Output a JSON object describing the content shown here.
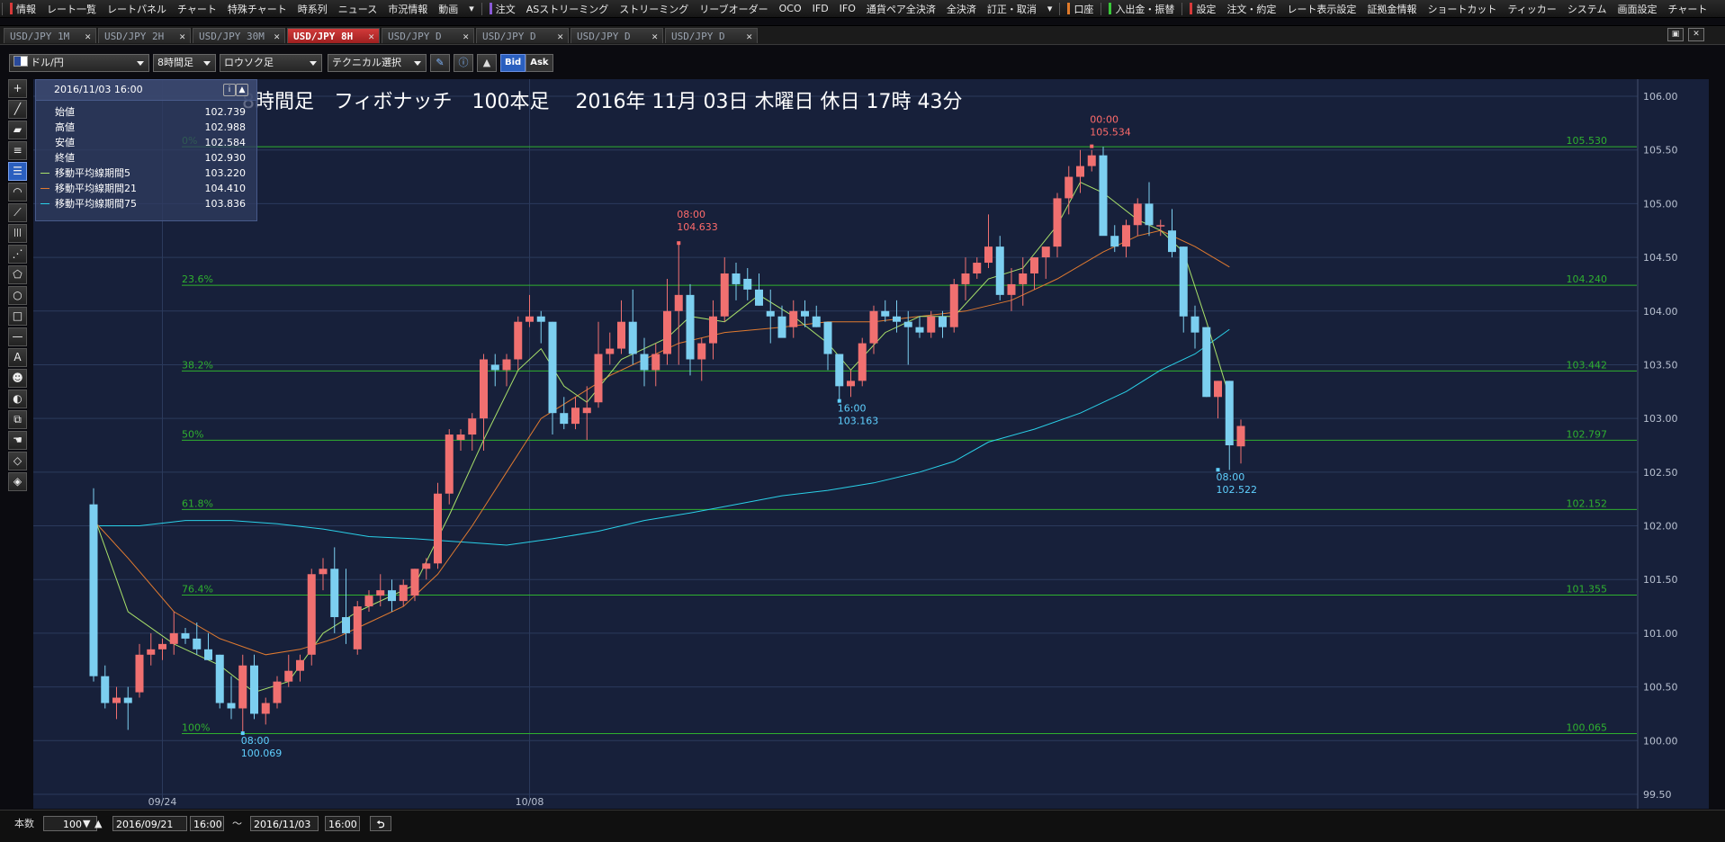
{
  "menu": {
    "items": [
      {
        "label": "情報",
        "mark": "#d83a3a"
      },
      {
        "label": "レート一覧"
      },
      {
        "label": "レートパネル"
      },
      {
        "label": "チャート"
      },
      {
        "label": "特殊チャート"
      },
      {
        "label": "時系列"
      },
      {
        "label": "ニュース"
      },
      {
        "label": "市況情報"
      },
      {
        "label": "動画"
      },
      {
        "label": "▾"
      },
      {
        "label": "注文",
        "mark": "#8a5ad8"
      },
      {
        "label": "ASストリーミング"
      },
      {
        "label": "ストリーミング"
      },
      {
        "label": "リーブオーダー"
      },
      {
        "label": "OCO"
      },
      {
        "label": "IFD"
      },
      {
        "label": "IFO"
      },
      {
        "label": "通貨ペア全決済"
      },
      {
        "label": "全決済"
      },
      {
        "label": "訂正・取消"
      },
      {
        "label": "▾"
      },
      {
        "label": "口座",
        "mark": "#e07a2a"
      },
      {
        "label": "入出金・振替",
        "mark": "#3ac83a"
      },
      {
        "label": "設定",
        "mark": "#d83a3a"
      },
      {
        "label": "注文・約定"
      },
      {
        "label": "レート表示設定"
      },
      {
        "label": "証拠金情報"
      },
      {
        "label": "ショートカット"
      },
      {
        "label": "ティッカー"
      },
      {
        "label": "システム"
      },
      {
        "label": "画面設定"
      },
      {
        "label": "チャート"
      }
    ]
  },
  "tabs": [
    {
      "label": "USD/JPY 1M",
      "active": false
    },
    {
      "label": "USD/JPY 2H",
      "active": false
    },
    {
      "label": "USD/JPY 30M",
      "active": false
    },
    {
      "label": "USD/JPY 8H",
      "active": true
    },
    {
      "label": "USD/JPY D",
      "active": false
    },
    {
      "label": "USD/JPY D",
      "active": false
    },
    {
      "label": "USD/JPY D",
      "active": false
    },
    {
      "label": "USD/JPY D",
      "active": false
    }
  ],
  "toolbar": {
    "pair": "ドル/円",
    "timeframe": "8時間足",
    "chart_type": "ロウソク足",
    "technical": "テクニカル選択",
    "bid": "Bid",
    "ask": "Ask"
  },
  "left_tools": [
    "crosshair-tool",
    "line-tool",
    "ruler-tool",
    "hline-tool",
    "fibonacci-tool",
    "fib-arc-tool",
    "fan-tool",
    "vlines-tool",
    "pitchfork-tool",
    "pentagon-tool",
    "circle-tool",
    "rect-tool",
    "hbar-tool",
    "text-tool",
    "stamp-tool",
    "palette-tool",
    "copy-tool",
    "hand-tool",
    "eraser-tool",
    "eraser-all-tool"
  ],
  "ohlc_panel": {
    "datetime": "2016/11/03 16:00",
    "rows": [
      {
        "label": "始値",
        "value": "102.739"
      },
      {
        "label": "高値",
        "value": "102.988"
      },
      {
        "label": "安値",
        "value": "102.584"
      },
      {
        "label": "終値",
        "value": "102.930"
      },
      {
        "label": "移動平均線期間5",
        "value": "103.220",
        "color": "#a8e06a"
      },
      {
        "label": "移動平均線期間21",
        "value": "104.410",
        "color": "#e07a30"
      },
      {
        "label": "移動平均線期間75",
        "value": "103.836",
        "color": "#2ad0e8"
      }
    ]
  },
  "overlay_title": "8時間足　フィボナッチ　100本足　 2016年 11月 03日 木曜日 休日 17時 43分",
  "annotations": [
    {
      "time": "00:00",
      "price": "105.534",
      "color": "#ff6b6b"
    },
    {
      "time": "08:00",
      "price": "104.633",
      "color": "#ff6b6b"
    },
    {
      "time": "16:00",
      "price": "103.163",
      "color": "#5fd0ff"
    },
    {
      "time": "08:00",
      "price": "100.069",
      "color": "#5fd0ff"
    },
    {
      "time": "08:00",
      "price": "102.522",
      "color": "#5fd0ff"
    }
  ],
  "bottom": {
    "bars_label": "本数",
    "bars_value": "100",
    "from_date": "2016/09/21",
    "from_time": "16:00",
    "tilde": "～",
    "to_date": "2016/11/03",
    "to_time": "16:00"
  },
  "chart_data": {
    "type": "candlestick",
    "ylim": [
      99.5,
      106.0
    ],
    "y_ticks": [
      "106.00",
      "105.50",
      "105.00",
      "104.50",
      "104.00",
      "103.50",
      "103.00",
      "102.50",
      "102.00",
      "101.50",
      "101.00",
      "100.50",
      "100.00",
      "99.50"
    ],
    "x_labels": [
      {
        "label": "09/24",
        "bar": 6
      },
      {
        "label": "10/08",
        "bar": 38
      }
    ],
    "fibonacci": [
      {
        "label": "0%",
        "price": 105.53,
        "value_label": "105.530"
      },
      {
        "label": "23.6%",
        "price": 104.24,
        "value_label": "104.240"
      },
      {
        "label": "38.2%",
        "price": 103.442,
        "value_label": "103.442"
      },
      {
        "label": "50%",
        "price": 102.797,
        "value_label": "102.797"
      },
      {
        "label": "61.8%",
        "price": 102.152,
        "value_label": "102.152"
      },
      {
        "label": "76.4%",
        "price": 101.355,
        "value_label": "101.355"
      },
      {
        "label": "100%",
        "price": 100.065,
        "value_label": "100.065"
      }
    ],
    "colors": {
      "up": "#f07070",
      "down": "#7ccff0",
      "fib": "#2fb02f",
      "ma5": "#a8e06a",
      "ma21": "#e07a30",
      "ma75": "#2ad0e8",
      "grid": "#2b3a5c"
    },
    "candles": [
      [
        102.2,
        102.35,
        100.55,
        100.6
      ],
      [
        100.6,
        100.7,
        100.3,
        100.35
      ],
      [
        100.35,
        100.5,
        100.2,
        100.4
      ],
      [
        100.4,
        100.5,
        100.1,
        100.35
      ],
      [
        100.45,
        100.9,
        100.4,
        100.8
      ],
      [
        100.8,
        101.0,
        100.7,
        100.85
      ],
      [
        100.85,
        100.95,
        100.75,
        100.9
      ],
      [
        100.9,
        101.2,
        100.8,
        101.0
      ],
      [
        101.0,
        101.05,
        100.9,
        100.95
      ],
      [
        100.95,
        101.1,
        100.8,
        100.85
      ],
      [
        100.85,
        101.0,
        100.8,
        100.75
      ],
      [
        100.8,
        100.8,
        100.3,
        100.35
      ],
      [
        100.35,
        100.6,
        100.2,
        100.3
      ],
      [
        100.3,
        100.8,
        100.07,
        100.7
      ],
      [
        100.7,
        100.8,
        100.2,
        100.25
      ],
      [
        100.25,
        100.4,
        100.15,
        100.35
      ],
      [
        100.35,
        100.6,
        100.3,
        100.55
      ],
      [
        100.55,
        100.8,
        100.5,
        100.65
      ],
      [
        100.65,
        100.8,
        100.55,
        100.75
      ],
      [
        100.8,
        101.6,
        100.7,
        101.55
      ],
      [
        101.55,
        101.7,
        101.4,
        101.6
      ],
      [
        101.6,
        101.8,
        101.0,
        101.15
      ],
      [
        101.15,
        101.6,
        100.9,
        101.0
      ],
      [
        100.85,
        101.3,
        100.8,
        101.25
      ],
      [
        101.25,
        101.4,
        101.2,
        101.35
      ],
      [
        101.35,
        101.55,
        101.25,
        101.4
      ],
      [
        101.4,
        101.5,
        101.2,
        101.3
      ],
      [
        101.3,
        101.5,
        101.25,
        101.45
      ],
      [
        101.35,
        101.6,
        101.3,
        101.6
      ],
      [
        101.6,
        101.7,
        101.5,
        101.65
      ],
      [
        101.65,
        102.4,
        101.6,
        102.3
      ],
      [
        102.3,
        102.9,
        102.2,
        102.85
      ],
      [
        102.8,
        102.9,
        102.7,
        102.85
      ],
      [
        102.85,
        103.05,
        102.7,
        103.0
      ],
      [
        103.0,
        103.6,
        102.7,
        103.55
      ],
      [
        103.5,
        103.6,
        103.3,
        103.45
      ],
      [
        103.45,
        103.6,
        103.3,
        103.55
      ],
      [
        103.55,
        103.95,
        103.45,
        103.9
      ],
      [
        103.9,
        104.15,
        103.85,
        103.95
      ],
      [
        103.95,
        104.0,
        103.7,
        103.9
      ],
      [
        103.9,
        103.9,
        102.85,
        103.05
      ],
      [
        103.05,
        103.2,
        102.9,
        102.95
      ],
      [
        102.95,
        103.2,
        102.9,
        103.1
      ],
      [
        103.05,
        103.3,
        102.8,
        103.1
      ],
      [
        103.15,
        103.9,
        103.1,
        103.6
      ],
      [
        103.6,
        103.8,
        103.5,
        103.65
      ],
      [
        103.65,
        104.1,
        103.6,
        103.9
      ],
      [
        103.9,
        104.2,
        103.5,
        103.6
      ],
      [
        103.6,
        103.75,
        103.3,
        103.45
      ],
      [
        103.45,
        103.7,
        103.3,
        103.6
      ],
      [
        103.6,
        104.3,
        103.5,
        104.0
      ],
      [
        104.0,
        104.63,
        103.5,
        104.15
      ],
      [
        104.15,
        104.25,
        103.4,
        103.55
      ],
      [
        103.55,
        103.75,
        103.35,
        103.7
      ],
      [
        103.7,
        104.1,
        103.55,
        103.95
      ],
      [
        103.95,
        104.5,
        103.9,
        104.35
      ],
      [
        104.35,
        104.45,
        104.1,
        104.25
      ],
      [
        104.3,
        104.4,
        104.1,
        104.2
      ],
      [
        104.2,
        104.35,
        104.05,
        104.05
      ],
      [
        104.0,
        104.2,
        103.7,
        103.95
      ],
      [
        103.95,
        104.05,
        103.8,
        103.75
      ],
      [
        103.85,
        104.1,
        103.75,
        104.0
      ],
      [
        104.0,
        104.1,
        103.85,
        103.95
      ],
      [
        103.95,
        104.05,
        103.85,
        103.85
      ],
      [
        103.9,
        103.9,
        103.45,
        103.6
      ],
      [
        103.6,
        103.6,
        103.16,
        103.3
      ],
      [
        103.3,
        103.45,
        103.2,
        103.35
      ],
      [
        103.35,
        103.75,
        103.3,
        103.7
      ],
      [
        103.7,
        104.05,
        103.6,
        104.0
      ],
      [
        104.0,
        104.1,
        103.9,
        103.95
      ],
      [
        103.95,
        104.1,
        103.8,
        103.9
      ],
      [
        103.9,
        104.0,
        103.5,
        103.85
      ],
      [
        103.85,
        103.95,
        103.75,
        103.8
      ],
      [
        103.8,
        104.0,
        103.75,
        103.95
      ],
      [
        103.95,
        104.0,
        103.75,
        103.85
      ],
      [
        103.85,
        104.3,
        103.8,
        104.25
      ],
      [
        104.25,
        104.5,
        104.1,
        104.35
      ],
      [
        104.35,
        104.5,
        104.3,
        104.45
      ],
      [
        104.45,
        104.9,
        104.4,
        104.6
      ],
      [
        104.6,
        104.7,
        104.1,
        104.15
      ],
      [
        104.15,
        104.4,
        104.0,
        104.25
      ],
      [
        104.25,
        104.5,
        104.05,
        104.35
      ],
      [
        104.35,
        104.5,
        104.2,
        104.5
      ],
      [
        104.5,
        104.55,
        104.3,
        104.6
      ],
      [
        104.6,
        105.1,
        104.5,
        105.05
      ],
      [
        105.05,
        105.35,
        104.9,
        105.25
      ],
      [
        105.25,
        105.5,
        105.1,
        105.35
      ],
      [
        105.35,
        105.5,
        105.3,
        105.45
      ],
      [
        105.45,
        105.53,
        105.0,
        104.7
      ],
      [
        104.7,
        104.8,
        104.55,
        104.6
      ],
      [
        104.6,
        104.85,
        104.5,
        104.8
      ],
      [
        104.8,
        105.05,
        104.7,
        105.0
      ],
      [
        105.0,
        105.2,
        104.7,
        104.8
      ],
      [
        104.8,
        104.85,
        104.7,
        104.8
      ],
      [
        104.75,
        104.95,
        104.5,
        104.55
      ],
      [
        104.6,
        104.6,
        103.8,
        103.95
      ],
      [
        103.95,
        104.05,
        103.65,
        103.8
      ],
      [
        103.85,
        103.85,
        103.2,
        103.2
      ],
      [
        103.2,
        103.35,
        103.0,
        103.35
      ],
      [
        103.35,
        103.35,
        102.52,
        102.75
      ],
      [
        102.74,
        102.99,
        102.58,
        102.93
      ]
    ],
    "ma5": [
      [
        0,
        102.1
      ],
      [
        3,
        101.2
      ],
      [
        7,
        100.9
      ],
      [
        11,
        100.7
      ],
      [
        14,
        100.45
      ],
      [
        17,
        100.55
      ],
      [
        20,
        101.0
      ],
      [
        23,
        101.2
      ],
      [
        28,
        101.45
      ],
      [
        31,
        102.1
      ],
      [
        34,
        102.8
      ],
      [
        37,
        103.45
      ],
      [
        39,
        103.65
      ],
      [
        41,
        103.3
      ],
      [
        43,
        103.15
      ],
      [
        46,
        103.55
      ],
      [
        50,
        103.75
      ],
      [
        52,
        103.95
      ],
      [
        55,
        103.9
      ],
      [
        58,
        104.15
      ],
      [
        61,
        103.95
      ],
      [
        64,
        103.7
      ],
      [
        66,
        103.45
      ],
      [
        69,
        103.8
      ],
      [
        72,
        103.95
      ],
      [
        75,
        103.95
      ],
      [
        78,
        104.3
      ],
      [
        81,
        104.4
      ],
      [
        84,
        104.8
      ],
      [
        86,
        105.2
      ],
      [
        88,
        105.1
      ],
      [
        91,
        104.85
      ],
      [
        93,
        104.75
      ],
      [
        95,
        104.55
      ],
      [
        97,
        103.9
      ],
      [
        99,
        103.2
      ]
    ],
    "ma21": [
      [
        0,
        102.05
      ],
      [
        3,
        101.7
      ],
      [
        7,
        101.2
      ],
      [
        11,
        100.95
      ],
      [
        15,
        100.8
      ],
      [
        18,
        100.85
      ],
      [
        21,
        100.95
      ],
      [
        24,
        101.1
      ],
      [
        27,
        101.25
      ],
      [
        30,
        101.55
      ],
      [
        33,
        102.0
      ],
      [
        36,
        102.5
      ],
      [
        39,
        103.0
      ],
      [
        42,
        103.2
      ],
      [
        45,
        103.4
      ],
      [
        48,
        103.55
      ],
      [
        51,
        103.7
      ],
      [
        55,
        103.8
      ],
      [
        60,
        103.85
      ],
      [
        64,
        103.9
      ],
      [
        68,
        103.9
      ],
      [
        72,
        103.95
      ],
      [
        76,
        104.0
      ],
      [
        80,
        104.1
      ],
      [
        84,
        104.3
      ],
      [
        88,
        104.55
      ],
      [
        91,
        104.7
      ],
      [
        93,
        104.75
      ],
      [
        96,
        104.6
      ],
      [
        99,
        104.41
      ]
    ],
    "ma75": [
      [
        0,
        102.0
      ],
      [
        4,
        102.0
      ],
      [
        8,
        102.05
      ],
      [
        12,
        102.05
      ],
      [
        16,
        102.02
      ],
      [
        20,
        101.97
      ],
      [
        24,
        101.9
      ],
      [
        28,
        101.88
      ],
      [
        32,
        101.85
      ],
      [
        36,
        101.82
      ],
      [
        40,
        101.88
      ],
      [
        44,
        101.95
      ],
      [
        48,
        102.05
      ],
      [
        52,
        102.12
      ],
      [
        56,
        102.2
      ],
      [
        60,
        102.28
      ],
      [
        64,
        102.33
      ],
      [
        68,
        102.4
      ],
      [
        72,
        102.5
      ],
      [
        75,
        102.6
      ],
      [
        78,
        102.78
      ],
      [
        82,
        102.9
      ],
      [
        86,
        103.05
      ],
      [
        90,
        103.25
      ],
      [
        93,
        103.45
      ],
      [
        96,
        103.6
      ],
      [
        99,
        103.83
      ]
    ]
  }
}
